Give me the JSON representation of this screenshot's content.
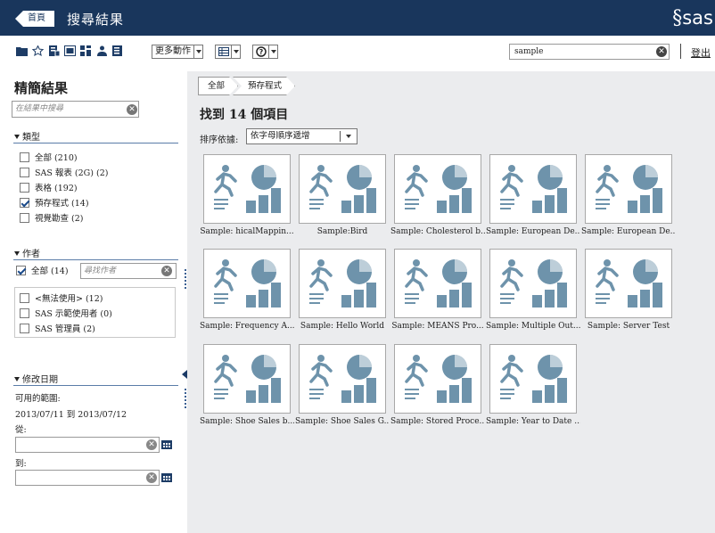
{
  "header": {
    "home_label": "首頁",
    "title": "搜尋結果",
    "logo": "sas"
  },
  "toolbar": {
    "icons": [
      "folder-icon",
      "star-icon",
      "report-icon",
      "table-icon",
      "stored-process-icon",
      "users-icon",
      "filter-icon"
    ],
    "more_actions": "更多動作",
    "search_value": "sample",
    "logout": "登出"
  },
  "sidebar": {
    "title": "精簡結果",
    "search_placeholder": "在結果中搜尋",
    "type": {
      "heading": "類型",
      "items": [
        {
          "label": "全部 (210)",
          "checked": false
        },
        {
          "label": "SAS 報表 (2G) (2)",
          "checked": false
        },
        {
          "label": "表格 (192)",
          "checked": false
        },
        {
          "label": "預存程式 (14)",
          "checked": true
        },
        {
          "label": "視覺勘查 (2)",
          "checked": false
        }
      ]
    },
    "author": {
      "heading": "作者",
      "all_label": "全部 (14)",
      "search_placeholder": "尋找作者",
      "items": [
        {
          "label": "<無法使用> (12)"
        },
        {
          "label": "SAS 示範使用者 (0)"
        },
        {
          "label": "SAS 管理員 (2)"
        }
      ]
    },
    "modified": {
      "heading": "修改日期",
      "range_label": "可用的範圍:",
      "range_value": "2013/07/11 到 2013/07/12",
      "from_label": "從:",
      "to_label": "到:"
    }
  },
  "main": {
    "breadcrumbs": [
      "全部",
      "預存程式"
    ],
    "found": "找到 14 個項目",
    "sort_label": "排序依據:",
    "sort_value": "依字母順序遞增",
    "items": [
      "Sample: hicalMappin...",
      "Sample:Bird",
      "Sample: Cholesterol b...",
      "Sample: European De...",
      "Sample: European De...",
      "Sample: Frequency A...",
      "Sample: Hello World",
      "Sample: MEANS Pro...",
      "Sample: Multiple Out...",
      "Sample: Server Test",
      "Sample: Shoe Sales b...",
      "Sample: Shoe Sales G...",
      "Sample: Stored Proce...",
      "Sample: Year to Date ..."
    ]
  },
  "colors": {
    "header": "#19365c",
    "accent": "#5a7ca8",
    "thumb_icon": "#6e93ab",
    "clear": "#5a5a5a"
  }
}
